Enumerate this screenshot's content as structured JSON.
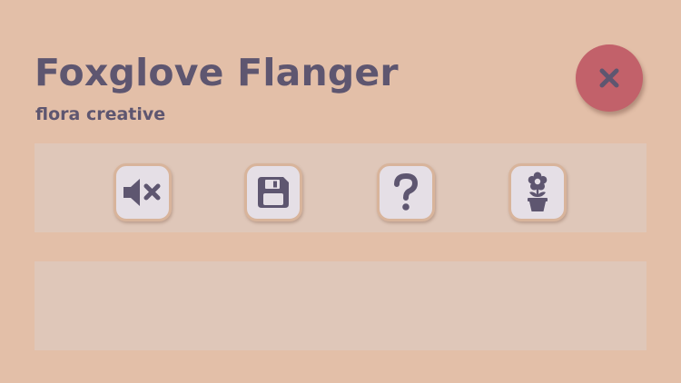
{
  "app": {
    "title": "Foxglove Flanger",
    "subtitle": "flora creative"
  },
  "header": {
    "close_icon": "close-icon"
  },
  "toolbar": {
    "buttons": [
      {
        "id": "mute",
        "icon": "speaker-mute-icon"
      },
      {
        "id": "save",
        "icon": "floppy-disk-icon"
      },
      {
        "id": "help",
        "icon": "question-mark-icon"
      },
      {
        "id": "flower",
        "icon": "flower-pot-icon"
      }
    ]
  },
  "colors": {
    "background": "#e3bfa8",
    "panel": "#dfc7b9",
    "text": "#5e5670",
    "close_button": "#c2616a",
    "tool_button": "#e5dfe6",
    "tool_button_border": "#d8b49b"
  }
}
